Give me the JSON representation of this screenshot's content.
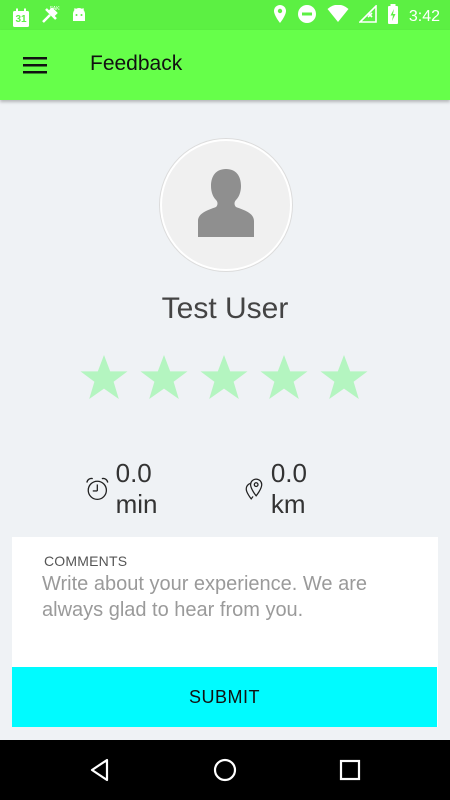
{
  "status_bar": {
    "time": "3:42",
    "calendar_day": "31",
    "icons": [
      "calendar-icon",
      "fake-gps-icon",
      "android-icon",
      "location-icon",
      "do-not-disturb-icon",
      "wifi-icon",
      "no-signal-icon",
      "battery-charging-icon"
    ]
  },
  "app_bar": {
    "title": "Feedback",
    "menu_icon": "hamburger-menu-icon"
  },
  "profile": {
    "name": "Test User",
    "avatar_icon": "person-silhouette-icon"
  },
  "rating": {
    "max": 5,
    "value": 5,
    "color": "#b4f5c0"
  },
  "stats": {
    "duration": "0.0 min",
    "distance": "0.0 km"
  },
  "comments": {
    "label": "COMMENTS",
    "placeholder": "Write about your experience. We are always glad to hear from you.",
    "value": ""
  },
  "submit": {
    "label": "SUBMIT",
    "color": "#00fbff"
  },
  "nav_bar": {
    "buttons": [
      "back-icon",
      "home-icon",
      "recents-icon"
    ]
  },
  "colors": {
    "status_bar": "#5cf043",
    "app_bar": "#66ff4a",
    "background": "#eff2f5"
  }
}
